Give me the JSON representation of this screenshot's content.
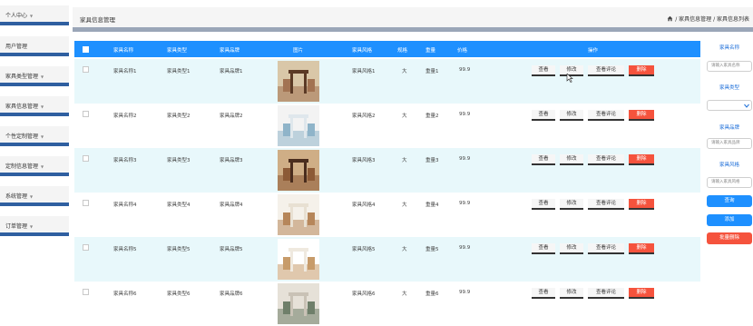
{
  "sidebar": {
    "items": [
      {
        "label": "个人中心"
      },
      {
        "label": "用户管理"
      },
      {
        "label": "家具类型管理"
      },
      {
        "label": "家具信息管理"
      },
      {
        "label": "个性定制管理"
      },
      {
        "label": "定制信息管理"
      },
      {
        "label": "系统管理"
      },
      {
        "label": "订单管理"
      }
    ]
  },
  "header": {
    "title": "家具信息管理",
    "breadcrumb": "/ 家具信息管理 / 家具信息列表"
  },
  "table": {
    "columns": [
      "家具名称",
      "家具类型",
      "家具品牌",
      "图片",
      "家具风格",
      "规格",
      "重量",
      "价格",
      "操作"
    ],
    "actions": {
      "view": "查看",
      "edit": "修改",
      "comments": "查看评论",
      "delete": "删除"
    },
    "rows": [
      {
        "name": "家具名称1",
        "type": "家具类型1",
        "brand": "家具品牌1",
        "style": "家具风格1",
        "spec": "大",
        "weight": "重量1",
        "price": "99.9"
      },
      {
        "name": "家具名称2",
        "type": "家具类型2",
        "brand": "家具品牌2",
        "style": "家具风格2",
        "spec": "大",
        "weight": "重量2",
        "price": "99.9"
      },
      {
        "name": "家具名称3",
        "type": "家具类型3",
        "brand": "家具品牌3",
        "style": "家具风格3",
        "spec": "大",
        "weight": "重量3",
        "price": "99.9"
      },
      {
        "name": "家具名称4",
        "type": "家具类型4",
        "brand": "家具品牌4",
        "style": "家具风格4",
        "spec": "大",
        "weight": "重量4",
        "price": "99.9"
      },
      {
        "name": "家具名称5",
        "type": "家具类型5",
        "brand": "家具品牌5",
        "style": "家具风格5",
        "spec": "大",
        "weight": "重量5",
        "price": "99.9"
      },
      {
        "name": "家具名称6",
        "type": "家具类型6",
        "brand": "家具品牌6",
        "style": "家具风格6",
        "spec": "大",
        "weight": "重量6",
        "price": "99.9"
      }
    ]
  },
  "search_panel": {
    "name_label": "家具名称",
    "name_placeholder": "请输入家具名称",
    "type_label": "家具类型",
    "brand_label": "家具品牌",
    "brand_placeholder": "请输入家具品牌",
    "style_label": "家具风格",
    "style_placeholder": "请输入家具风格",
    "search_button": "查询",
    "add_button": "添加",
    "batch_delete_button": "批量删除"
  },
  "colors": {
    "accent": "#1e90ff",
    "danger": "#f5533d",
    "sidebar_bar": "#2f5fa0",
    "row_alt": "#e8f8fb"
  }
}
